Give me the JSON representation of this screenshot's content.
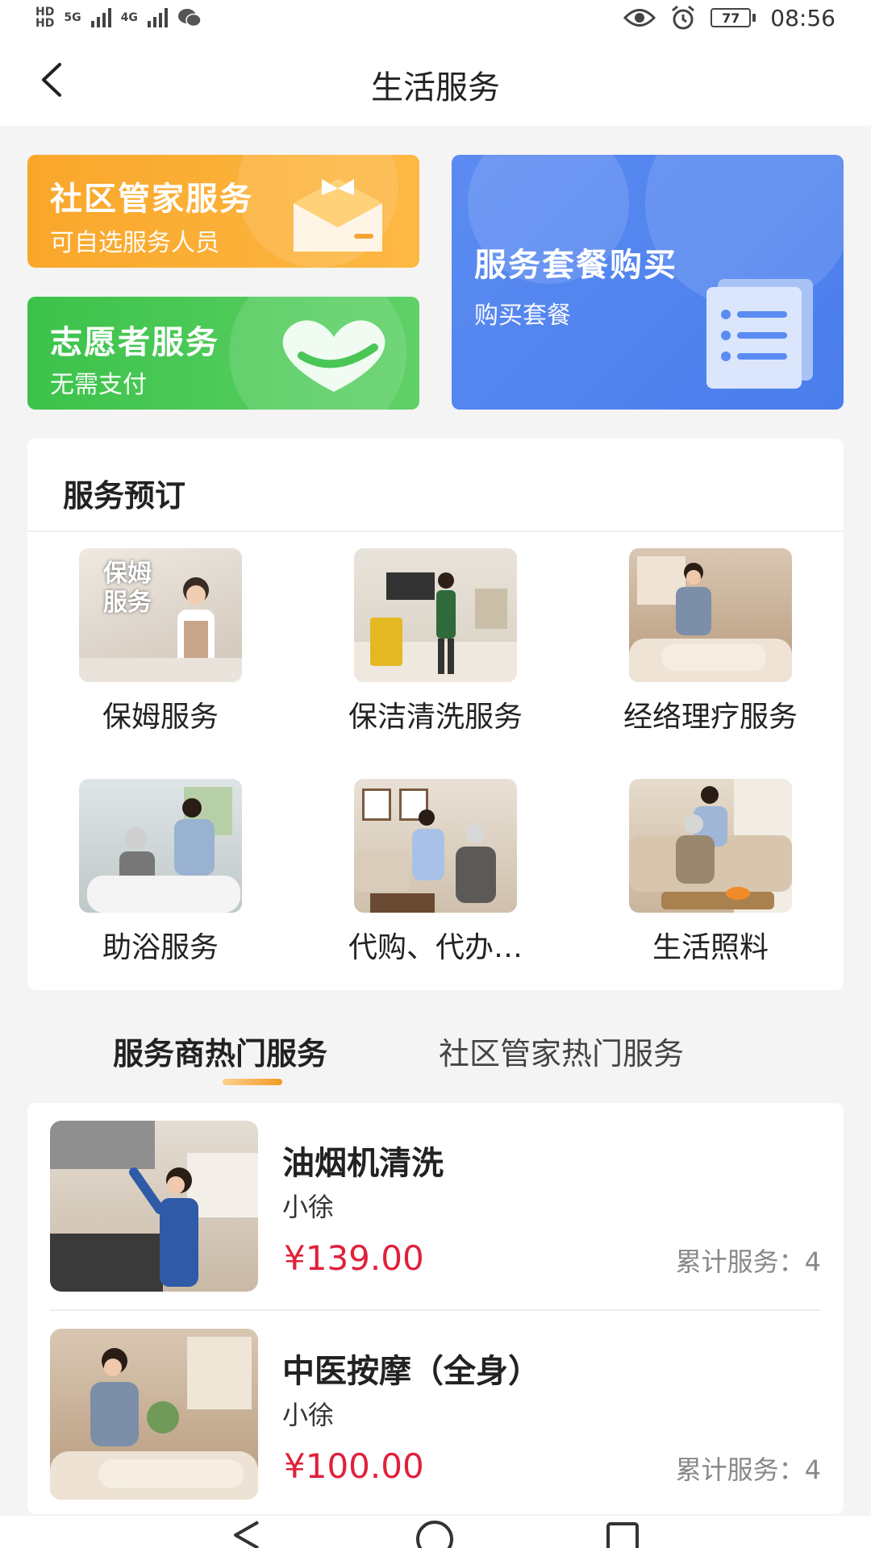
{
  "status_bar": {
    "hd1": "HD",
    "hd2": "HD",
    "net1": "5G",
    "net2": "4G",
    "battery": "77",
    "time": "08:56"
  },
  "nav": {
    "title": "生活服务"
  },
  "cards": {
    "steward": {
      "title": "社区管家服务",
      "subtitle": "可自选服务人员"
    },
    "volunteer": {
      "title": "志愿者服务",
      "subtitle": "无需支付"
    },
    "package": {
      "title": "服务套餐购买",
      "subtitle": "购买套餐"
    }
  },
  "booking": {
    "title": "服务预订",
    "thumb_overlay": "保姆\n服务",
    "items": [
      {
        "label": "保姆服务"
      },
      {
        "label": "保洁清洗服务"
      },
      {
        "label": "经络理疗服务"
      },
      {
        "label": "助浴服务"
      },
      {
        "label": "代购、代办…"
      },
      {
        "label": "生活照料"
      }
    ]
  },
  "tabs": [
    {
      "label": "服务商热门服务",
      "active": true
    },
    {
      "label": "社区管家热门服务",
      "active": false
    }
  ],
  "services": [
    {
      "name": "油烟机清洗",
      "provider": "小徐",
      "price": "¥139.00",
      "count": "累计服务：4"
    },
    {
      "name": "中医按摩（全身）",
      "provider": "小徐",
      "price": "¥100.00",
      "count": "累计服务：4"
    }
  ],
  "colors": {
    "orange_card": "#f9a72b",
    "green_card": "#3cc24a",
    "blue_card": "#5b8bf2",
    "price_red": "#e0213b",
    "tab_indicator": "#f39a23"
  }
}
